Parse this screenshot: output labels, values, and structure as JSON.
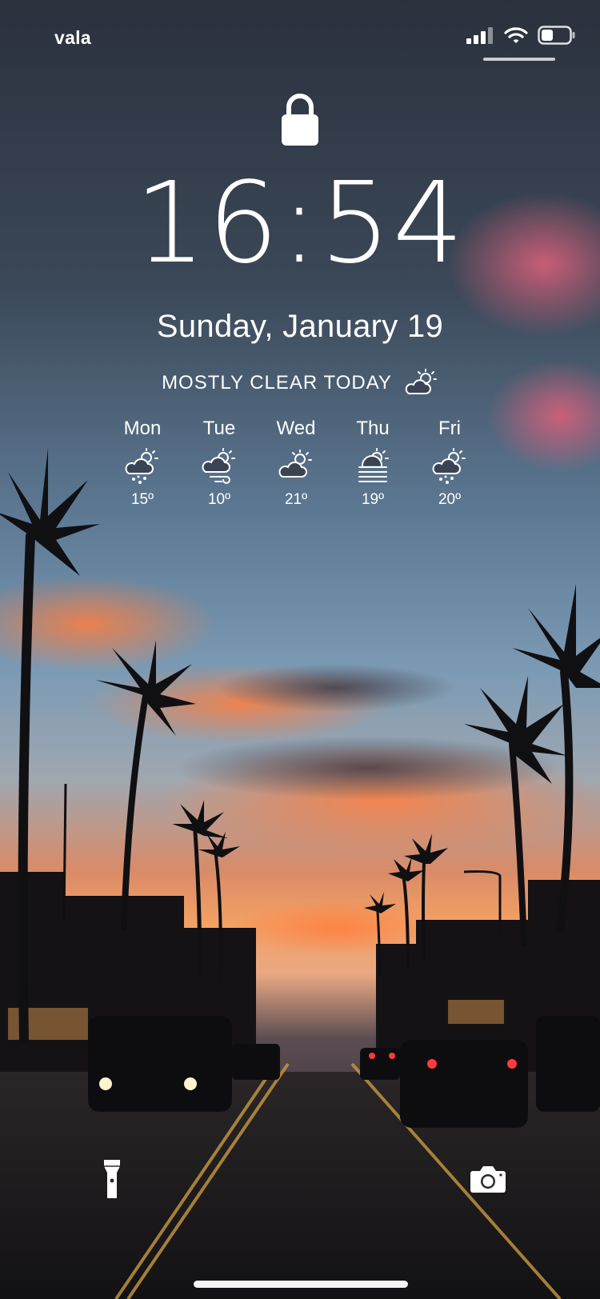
{
  "status_bar": {
    "carrier": "vala",
    "icons": [
      "cellular-signal-icon",
      "wifi-icon",
      "battery-icon"
    ]
  },
  "lock_icon": "lock-icon",
  "lock_screen": {
    "time": "16:54",
    "date": "Sunday, January 19"
  },
  "weather": {
    "summary": "MOSTLY CLEAR TODAY",
    "summary_icon": "partly-cloudy-icon",
    "forecast": [
      {
        "day": "Mon",
        "icon": "cloudy-hail-icon",
        "temp": "15º"
      },
      {
        "day": "Tue",
        "icon": "windy-cloud-icon",
        "temp": "10º"
      },
      {
        "day": "Wed",
        "icon": "partly-cloudy-icon",
        "temp": "21º"
      },
      {
        "day": "Thu",
        "icon": "fog-icon",
        "temp": "19º"
      },
      {
        "day": "Fri",
        "icon": "cloudy-hail-icon",
        "temp": "20º"
      }
    ]
  },
  "quick_actions": {
    "left": "flashlight-icon",
    "right": "camera-icon"
  },
  "wallpaper": {
    "sky_top": "#2f3644",
    "sky_mid": "#6f8aa5",
    "glow": "#f07a4a",
    "cloud_pink": "#d55d78",
    "road": "#1b1a1c"
  }
}
